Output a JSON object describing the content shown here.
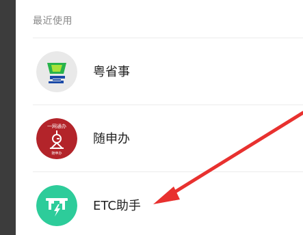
{
  "section": {
    "title": "最近使用"
  },
  "apps": [
    {
      "label": "粤省事",
      "icon": "yueshengshi-app-icon"
    },
    {
      "label": "随申办",
      "icon": "suishenban-app-icon",
      "icon_text": "一网通办",
      "icon_subtext": "随申办"
    },
    {
      "label": "ETC助手",
      "icon": "etc-helper-app-icon"
    }
  ],
  "colors": {
    "arrow": "#e8312f",
    "etc_icon": "#2dcc9a",
    "suishenban_icon": "#b3242a",
    "yueshengshi_icon_bg": "#e9e9e9",
    "yueshengshi_icon_green": "#28b34b"
  }
}
